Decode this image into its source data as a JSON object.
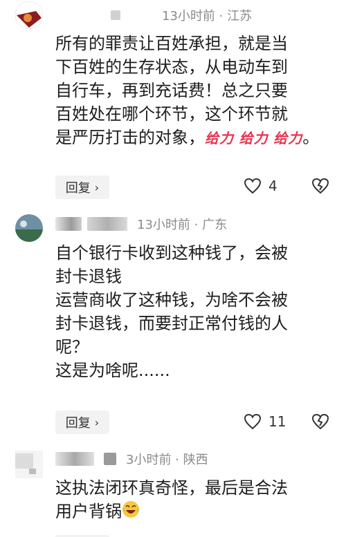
{
  "comments": [
    {
      "meta": "13小时前 · 江苏",
      "lines": [
        "所有的罪责让百姓承担，就是当",
        "下百姓的生存状态，从电动车到",
        "自行车，再到充话费！总之只要",
        "百姓处在哪个环节，这个环节就",
        "是严历打击的对象，"
      ],
      "sticker_words": [
        "给力",
        "给力",
        "给力"
      ],
      "end_mark": "。",
      "reply": "回复",
      "likes": "4"
    },
    {
      "meta": "13小时前 · 广东",
      "lines": [
        "自个银行卡收到这种钱了，会被",
        "封卡退钱",
        "运营商收了这种钱，为啥不会被",
        "封卡退钱，而要封正常付钱的人",
        "呢？",
        "这是为啥呢......"
      ],
      "reply": "回复",
      "likes": "11"
    },
    {
      "meta": "3小时前 · 陕西",
      "lines": [
        "这执法闭环真奇怪，最后是合法",
        "用户背锅"
      ],
      "emoji": "crying-laughing-emoji"
    }
  ],
  "icons": {
    "heart": "heart-outline-icon",
    "dislike": "broken-heart-icon",
    "chevron": "chevron-right-icon"
  },
  "colors": {
    "meta_text": "#8a8a8a",
    "sticker": "#e8344e",
    "reply_bg": "#f2f2f2"
  }
}
